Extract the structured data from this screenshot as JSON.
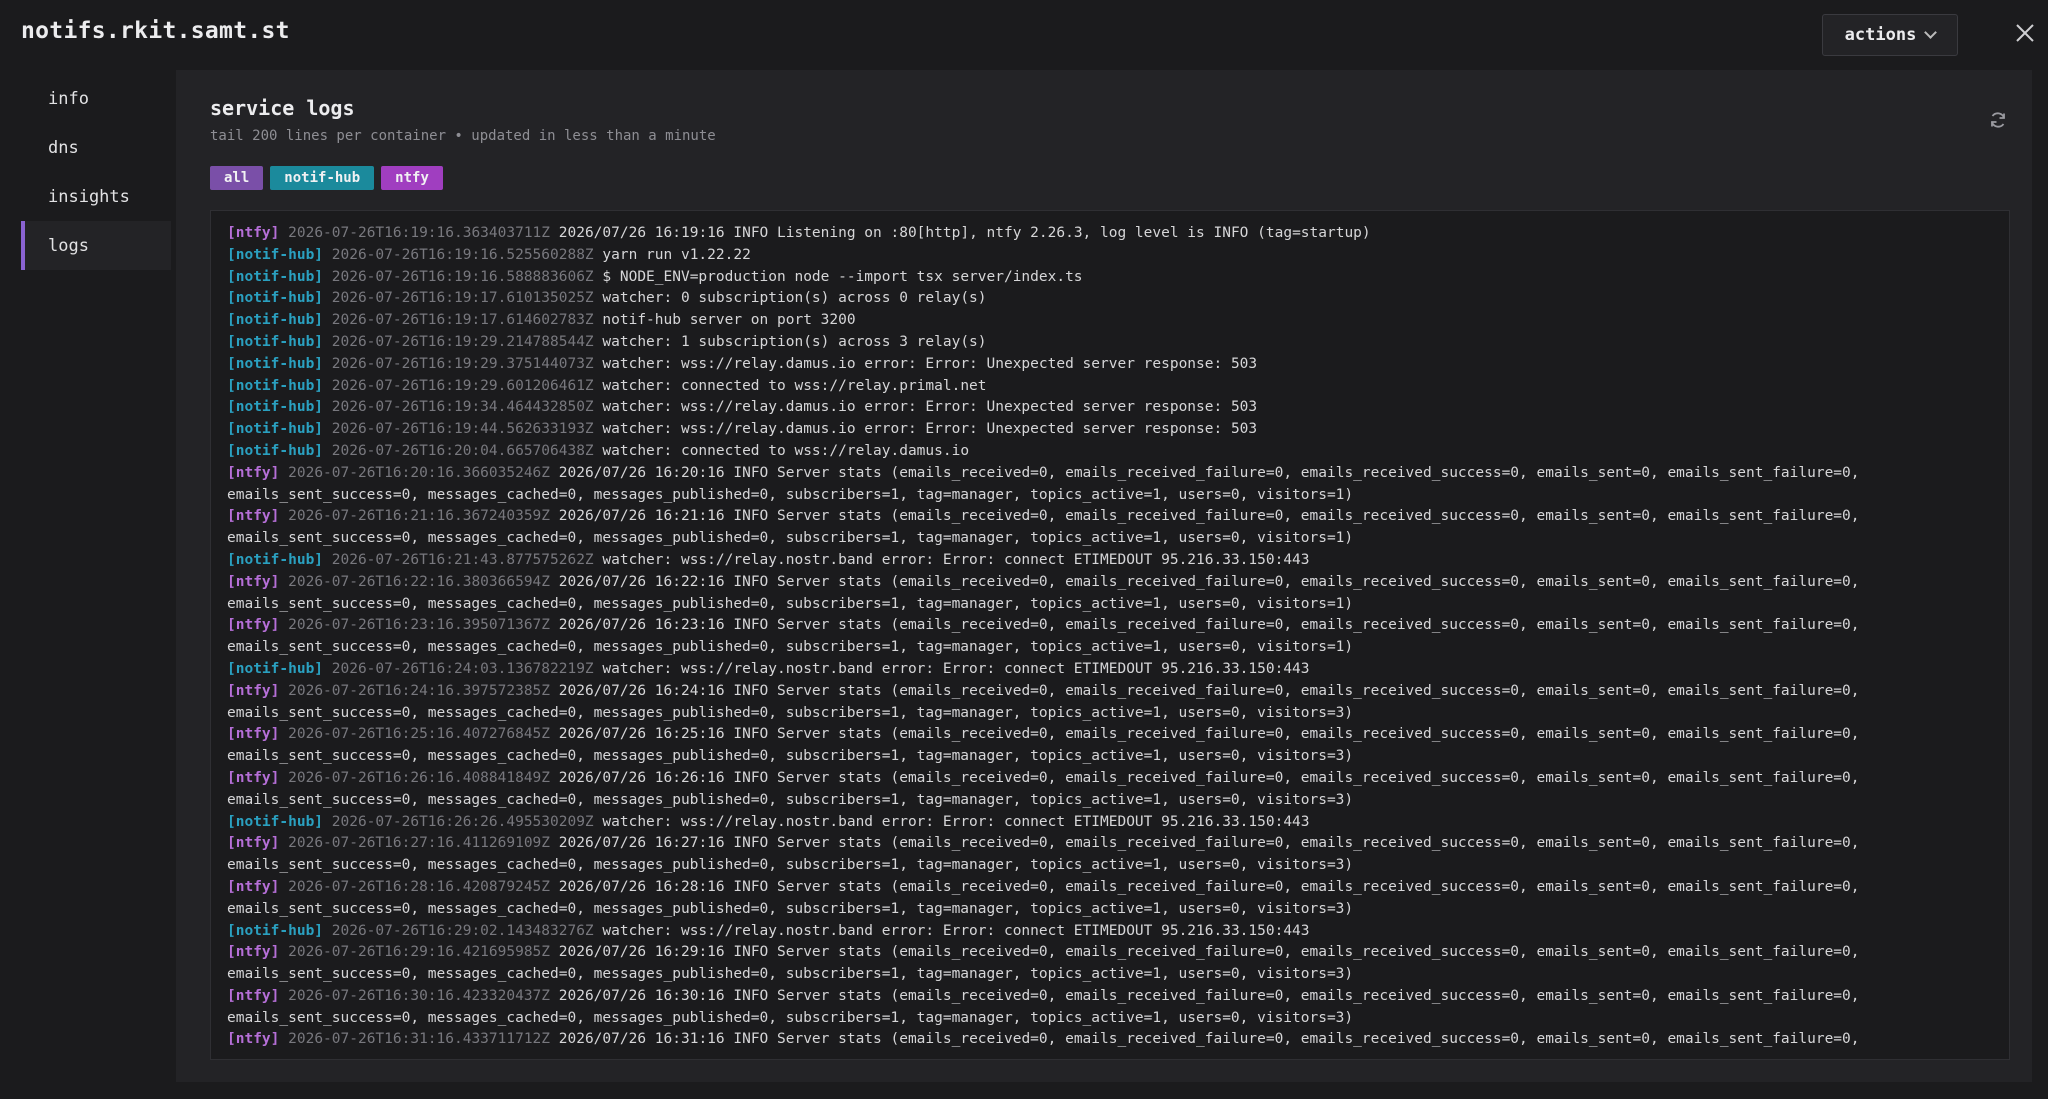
{
  "app": {
    "title": "notifs.rkit.samt.st",
    "actions_label": "actions"
  },
  "sidebar": {
    "items": [
      {
        "label": "info"
      },
      {
        "label": "dns"
      },
      {
        "label": "insights"
      },
      {
        "label": "logs",
        "active": true
      }
    ]
  },
  "panel": {
    "title": "service logs",
    "subtitle": "tail 200 lines per container • updated in less than a minute",
    "filters": [
      "all",
      "notif-hub",
      "ntfy"
    ]
  },
  "colors": {
    "accent": "#8a63d2",
    "ntfy_tag": "#b66fd8",
    "notif_hub_tag": "#2aa0c0",
    "chip_all": "#7a4fa8",
    "chip_notif_hub": "#1b8a9c",
    "chip_ntfy": "#a03ec0"
  },
  "logs": [
    {
      "tag": "[ntfy]",
      "ts": "2026-07-26T16:19:16.363403711Z",
      "msg": "2026/07/26 16:19:16 INFO Listening on :80[http], ntfy 2.26.3, log level is INFO (tag=startup)"
    },
    {
      "tag": "[notif-hub]",
      "ts": "2026-07-26T16:19:16.525560288Z",
      "msg": "yarn run v1.22.22"
    },
    {
      "tag": "[notif-hub]",
      "ts": "2026-07-26T16:19:16.588883606Z",
      "msg": "$ NODE_ENV=production node --import tsx server/index.ts"
    },
    {
      "tag": "[notif-hub]",
      "ts": "2026-07-26T16:19:17.610135025Z",
      "msg": "watcher: 0 subscription(s) across 0 relay(s)"
    },
    {
      "tag": "[notif-hub]",
      "ts": "2026-07-26T16:19:17.614602783Z",
      "msg": "notif-hub server on port 3200"
    },
    {
      "tag": "[notif-hub]",
      "ts": "2026-07-26T16:19:29.214788544Z",
      "msg": "watcher: 1 subscription(s) across 3 relay(s)"
    },
    {
      "tag": "[notif-hub]",
      "ts": "2026-07-26T16:19:29.375144073Z",
      "msg": "watcher: wss://relay.damus.io error: Error: Unexpected server response: 503"
    },
    {
      "tag": "[notif-hub]",
      "ts": "2026-07-26T16:19:29.601206461Z",
      "msg": "watcher: connected to wss://relay.primal.net"
    },
    {
      "tag": "[notif-hub]",
      "ts": "2026-07-26T16:19:34.464432850Z",
      "msg": "watcher: wss://relay.damus.io error: Error: Unexpected server response: 503"
    },
    {
      "tag": "[notif-hub]",
      "ts": "2026-07-26T16:19:44.562633193Z",
      "msg": "watcher: wss://relay.damus.io error: Error: Unexpected server response: 503"
    },
    {
      "tag": "[notif-hub]",
      "ts": "2026-07-26T16:20:04.665706438Z",
      "msg": "watcher: connected to wss://relay.damus.io"
    },
    {
      "tag": "[ntfy]",
      "ts": "2026-07-26T16:20:16.366035246Z",
      "msg": "2026/07/26 16:20:16 INFO Server stats (emails_received=0, emails_received_failure=0, emails_received_success=0, emails_sent=0, emails_sent_failure=0,",
      "cont": "emails_sent_success=0, messages_cached=0, messages_published=0, subscribers=1, tag=manager, topics_active=1, users=0, visitors=1)"
    },
    {
      "tag": "[ntfy]",
      "ts": "2026-07-26T16:21:16.367240359Z",
      "msg": "2026/07/26 16:21:16 INFO Server stats (emails_received=0, emails_received_failure=0, emails_received_success=0, emails_sent=0, emails_sent_failure=0,",
      "cont": "emails_sent_success=0, messages_cached=0, messages_published=0, subscribers=1, tag=manager, topics_active=1, users=0, visitors=1)"
    },
    {
      "tag": "[notif-hub]",
      "ts": "2026-07-26T16:21:43.877575262Z",
      "msg": "watcher: wss://relay.nostr.band error: Error: connect ETIMEDOUT 95.216.33.150:443"
    },
    {
      "tag": "[ntfy]",
      "ts": "2026-07-26T16:22:16.380366594Z",
      "msg": "2026/07/26 16:22:16 INFO Server stats (emails_received=0, emails_received_failure=0, emails_received_success=0, emails_sent=0, emails_sent_failure=0,",
      "cont": "emails_sent_success=0, messages_cached=0, messages_published=0, subscribers=1, tag=manager, topics_active=1, users=0, visitors=1)"
    },
    {
      "tag": "[ntfy]",
      "ts": "2026-07-26T16:23:16.395071367Z",
      "msg": "2026/07/26 16:23:16 INFO Server stats (emails_received=0, emails_received_failure=0, emails_received_success=0, emails_sent=0, emails_sent_failure=0,",
      "cont": "emails_sent_success=0, messages_cached=0, messages_published=0, subscribers=1, tag=manager, topics_active=1, users=0, visitors=1)"
    },
    {
      "tag": "[notif-hub]",
      "ts": "2026-07-26T16:24:03.136782219Z",
      "msg": "watcher: wss://relay.nostr.band error: Error: connect ETIMEDOUT 95.216.33.150:443"
    },
    {
      "tag": "[ntfy]",
      "ts": "2026-07-26T16:24:16.397572385Z",
      "msg": "2026/07/26 16:24:16 INFO Server stats (emails_received=0, emails_received_failure=0, emails_received_success=0, emails_sent=0, emails_sent_failure=0,",
      "cont": "emails_sent_success=0, messages_cached=0, messages_published=0, subscribers=1, tag=manager, topics_active=1, users=0, visitors=3)"
    },
    {
      "tag": "[ntfy]",
      "ts": "2026-07-26T16:25:16.407276845Z",
      "msg": "2026/07/26 16:25:16 INFO Server stats (emails_received=0, emails_received_failure=0, emails_received_success=0, emails_sent=0, emails_sent_failure=0,",
      "cont": "emails_sent_success=0, messages_cached=0, messages_published=0, subscribers=1, tag=manager, topics_active=1, users=0, visitors=3)"
    },
    {
      "tag": "[ntfy]",
      "ts": "2026-07-26T16:26:16.408841849Z",
      "msg": "2026/07/26 16:26:16 INFO Server stats (emails_received=0, emails_received_failure=0, emails_received_success=0, emails_sent=0, emails_sent_failure=0,",
      "cont": "emails_sent_success=0, messages_cached=0, messages_published=0, subscribers=1, tag=manager, topics_active=1, users=0, visitors=3)"
    },
    {
      "tag": "[notif-hub]",
      "ts": "2026-07-26T16:26:26.495530209Z",
      "msg": "watcher: wss://relay.nostr.band error: Error: connect ETIMEDOUT 95.216.33.150:443"
    },
    {
      "tag": "[ntfy]",
      "ts": "2026-07-26T16:27:16.411269109Z",
      "msg": "2026/07/26 16:27:16 INFO Server stats (emails_received=0, emails_received_failure=0, emails_received_success=0, emails_sent=0, emails_sent_failure=0,",
      "cont": "emails_sent_success=0, messages_cached=0, messages_published=0, subscribers=1, tag=manager, topics_active=1, users=0, visitors=3)"
    },
    {
      "tag": "[ntfy]",
      "ts": "2026-07-26T16:28:16.420879245Z",
      "msg": "2026/07/26 16:28:16 INFO Server stats (emails_received=0, emails_received_failure=0, emails_received_success=0, emails_sent=0, emails_sent_failure=0,",
      "cont": "emails_sent_success=0, messages_cached=0, messages_published=0, subscribers=1, tag=manager, topics_active=1, users=0, visitors=3)"
    },
    {
      "tag": "[notif-hub]",
      "ts": "2026-07-26T16:29:02.143483276Z",
      "msg": "watcher: wss://relay.nostr.band error: Error: connect ETIMEDOUT 95.216.33.150:443"
    },
    {
      "tag": "[ntfy]",
      "ts": "2026-07-26T16:29:16.421695985Z",
      "msg": "2026/07/26 16:29:16 INFO Server stats (emails_received=0, emails_received_failure=0, emails_received_success=0, emails_sent=0, emails_sent_failure=0,",
      "cont": "emails_sent_success=0, messages_cached=0, messages_published=0, subscribers=1, tag=manager, topics_active=1, users=0, visitors=3)"
    },
    {
      "tag": "[ntfy]",
      "ts": "2026-07-26T16:30:16.423320437Z",
      "msg": "2026/07/26 16:30:16 INFO Server stats (emails_received=0, emails_received_failure=0, emails_received_success=0, emails_sent=0, emails_sent_failure=0,",
      "cont": "emails_sent_success=0, messages_cached=0, messages_published=0, subscribers=1, tag=manager, topics_active=1, users=0, visitors=3)"
    },
    {
      "tag": "[ntfy]",
      "ts": "2026-07-26T16:31:16.433711712Z",
      "msg": "2026/07/26 16:31:16 INFO Server stats (emails_received=0, emails_received_failure=0, emails_received_success=0, emails_sent=0, emails_sent_failure=0,"
    }
  ]
}
